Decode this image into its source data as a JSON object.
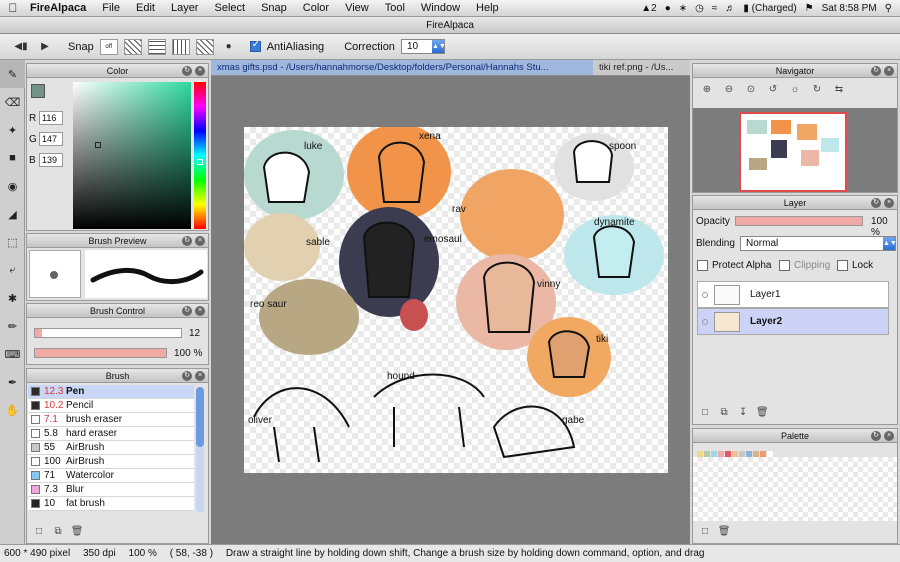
{
  "menubar": {
    "app": "FireAlpaca",
    "items": [
      "File",
      "Edit",
      "Layer",
      "Select",
      "Snap",
      "Color",
      "View",
      "Tool",
      "Window",
      "Help"
    ],
    "status": {
      "adobe": "2",
      "battery": "(Charged)",
      "clock": "Sat 8:58 PM"
    }
  },
  "window": {
    "title": "FireAlpaca"
  },
  "toolbar": {
    "snap_label": "Snap",
    "snap_off": "off",
    "antialias_label": "AntiAliasing",
    "correction_label": "Correction",
    "correction_value": "10"
  },
  "tabs": [
    {
      "label": "xmas gifts.psd - /Users/hannahmorse/Desktop/folders/Personal/Hannahs Stu..."
    },
    {
      "label": "tiki ref.png - /Us..."
    }
  ],
  "color_panel": {
    "title": "Color",
    "r_label": "R",
    "r": "116",
    "g_label": "G",
    "g": "147",
    "b_label": "B",
    "b": "139",
    "swatch": "#749388"
  },
  "brush_preview": {
    "title": "Brush Preview"
  },
  "brush_control": {
    "title": "Brush Control",
    "size": "12",
    "size_fraction": 0.05,
    "opacity": "100 %",
    "opacity_fraction": 1.0
  },
  "brush_list": {
    "title": "Brush",
    "items": [
      {
        "size": "12.3",
        "name": "Pen",
        "color": "#2b2b2b",
        "red": true,
        "bold": true
      },
      {
        "size": "10.2",
        "name": "Pencil",
        "color": "#2b2b2b",
        "red": true
      },
      {
        "size": "7.1",
        "name": "brush eraser",
        "color": "#ffffff",
        "red": true
      },
      {
        "size": "5.8",
        "name": "hard eraser",
        "color": "#ffffff"
      },
      {
        "size": "55",
        "name": "AirBrush",
        "color": "#c8c8c8"
      },
      {
        "size": "100",
        "name": "AirBrush",
        "color": "#ffffff"
      },
      {
        "size": "71",
        "name": "Watercolor",
        "color": "#88c8f0"
      },
      {
        "size": "7.3",
        "name": "Blur",
        "color": "#f0a8e0"
      },
      {
        "size": "10",
        "name": "fat brush",
        "color": "#222222"
      }
    ]
  },
  "navigator": {
    "title": "Navigator"
  },
  "layer_panel": {
    "title": "Layer",
    "opacity_label": "Opacity",
    "opacity": "100 %",
    "blending_label": "Blending",
    "blending": "Normal",
    "protect_alpha": "Protect Alpha",
    "clipping": "Clipping",
    "lock": "Lock",
    "layers": [
      "Layer1",
      "Layer2"
    ]
  },
  "palette": {
    "title": "Palette",
    "colors": [
      "#f3d68a",
      "#b7c9a8",
      "#9ad9e3",
      "#f2a8a8",
      "#e5556a",
      "#f7c08a",
      "#c6c6c6",
      "#8fb3d6",
      "#d9b48a",
      "#ef9b6a",
      "#ffffff"
    ]
  },
  "statusbar": {
    "size": "600 * 490 pixel",
    "dpi": "350 dpi",
    "zoom": "100 %",
    "coords": "( 58, -38 )",
    "hint": "Draw a straight line by holding down shift, Change a brush size by holding down command, option, and drag"
  },
  "canvas_labels": [
    "luke",
    "xena",
    "spoon",
    "rav",
    "sable",
    "emosaul",
    "dynamite",
    "reo saur",
    "vinny",
    "tiki",
    "oliver",
    "hound",
    "gabe"
  ]
}
